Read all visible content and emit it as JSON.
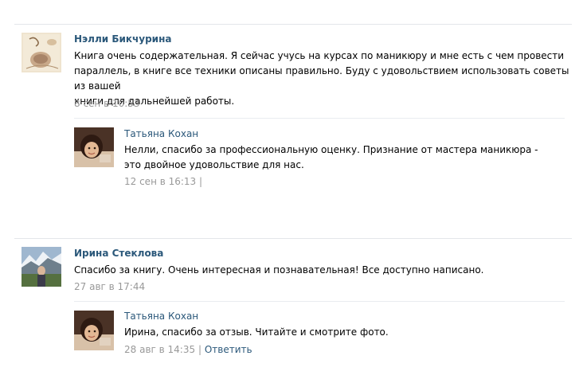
{
  "comments": [
    {
      "author": "Нэлли Бикчурина",
      "avatar_icon": "user-photo",
      "text_lines": [
        "Книга очень содержательная. Я сейчас учусь на курсах по маникюру и мне есть с чем провести",
        "параллель, в книге все техники описаны правильно. Буду с удовольствием использовать советы из вашей",
        "книги для дальнейшей работы."
      ],
      "date": "8 сен в 10:53",
      "reply": {
        "author": "Татьяна Кохан",
        "avatar_icon": "user-photo",
        "text_lines": [
          "Нелли, спасибо за профессиональную оценку. Признание от мастера маникюра -",
          "это двойное удовольствие для нас."
        ],
        "date": "12 сен в 16:13",
        "separator": "|"
      }
    },
    {
      "author": "Ирина Стеклова",
      "avatar_icon": "user-photo",
      "text_lines": [
        "Спасибо за книгу. Очень интересная и познавательная! Все доступно написано."
      ],
      "date": "27 авг в 17:44",
      "reply": {
        "author": "Татьяна Кохан",
        "avatar_icon": "user-photo",
        "text_lines": [
          "Ирина, спасибо за отзыв. Читайте и смотрите фото."
        ],
        "date": "28 авг в 14:35",
        "separator": "|",
        "action": "Ответить"
      }
    }
  ],
  "colors": {
    "link": "#2b587a",
    "meta": "#999999",
    "separator": "#e3e6ea"
  }
}
